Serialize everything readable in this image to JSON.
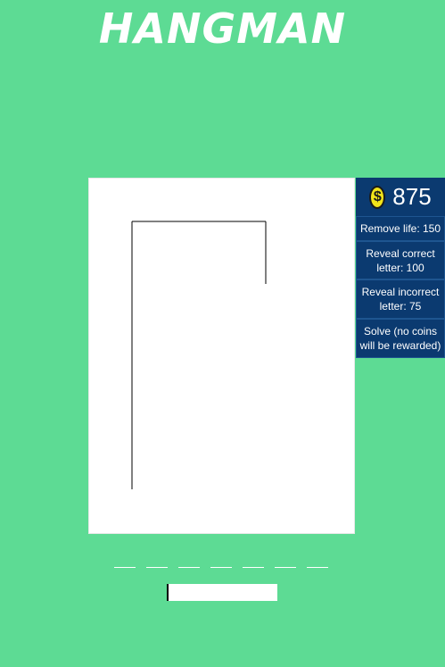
{
  "game": {
    "title": "HANGMAN"
  },
  "board": {
    "wrong_guesses": 0
  },
  "shop": {
    "coins": "875",
    "coin_icon": "dollar-coin-icon",
    "buttons": [
      {
        "label": "Remove life: 150"
      },
      {
        "label": "Reveal correct letter: 100"
      },
      {
        "label": "Reveal incorrect letter: 75"
      },
      {
        "label": "Solve (no coins will be rewarded)"
      }
    ]
  },
  "word": {
    "length": 7,
    "revealed": [
      "",
      "",
      "",
      "",
      "",
      "",
      ""
    ]
  },
  "guess": {
    "value": "",
    "placeholder": ""
  },
  "colors": {
    "background": "#5ddb94",
    "shop_panel": "#0b3a70",
    "coin": "#f2e41a"
  }
}
